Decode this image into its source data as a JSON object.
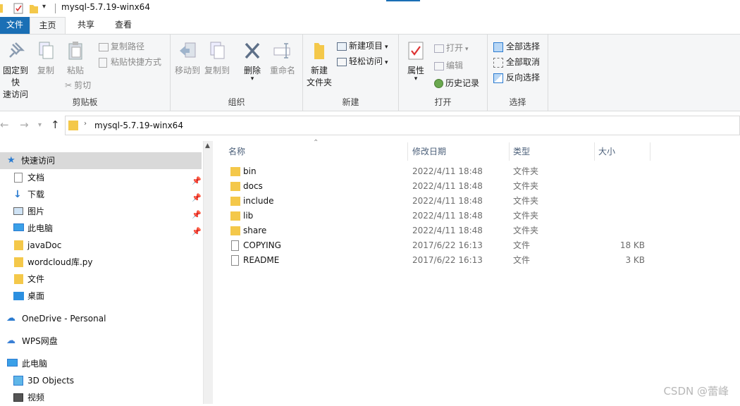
{
  "window": {
    "title": "mysql-5.7.19-winx64"
  },
  "tabs": [
    {
      "label": "文件"
    },
    {
      "label": "主页"
    },
    {
      "label": "共享"
    },
    {
      "label": "查看"
    }
  ],
  "ribbon": {
    "clipboard": {
      "label": "剪贴板",
      "pin_label": "固定到快速访问",
      "pin_line1": "固定到快",
      "pin_line2": "速访问",
      "copy": "复制",
      "paste": "粘贴",
      "copy_path": "复制路径",
      "paste_shortcut": "粘贴快捷方式",
      "cut": "剪切"
    },
    "organize": {
      "label": "组织",
      "move_to": "移动到",
      "copy_to": "复制到",
      "delete": "删除",
      "rename": "重命名"
    },
    "new": {
      "label": "新建",
      "new_folder_line1": "新建",
      "new_folder_line2": "文件夹",
      "new_item": "新建项目",
      "easy_access": "轻松访问"
    },
    "open": {
      "label": "打开",
      "properties": "属性",
      "open": "打开",
      "edit": "编辑",
      "history": "历史记录"
    },
    "select": {
      "label": "选择",
      "select_all": "全部选择",
      "select_none": "全部取消",
      "invert": "反向选择"
    }
  },
  "address": {
    "path": "mysql-5.7.19-winx64"
  },
  "nav": {
    "quick_access": "快速访问",
    "items": [
      {
        "label": "文档",
        "icon": "document-icon",
        "pinned": true
      },
      {
        "label": "下载",
        "icon": "download-icon",
        "pinned": true
      },
      {
        "label": "图片",
        "icon": "picture-icon",
        "pinned": true
      },
      {
        "label": "此电脑",
        "icon": "computer-icon",
        "pinned": true
      },
      {
        "label": "javaDoc",
        "icon": "folder-icon",
        "pinned": false
      },
      {
        "label": "wordcloud库.py",
        "icon": "folder-icon",
        "pinned": false
      },
      {
        "label": "文件",
        "icon": "folder-icon",
        "pinned": false
      },
      {
        "label": "桌面",
        "icon": "desktop-icon",
        "pinned": false
      }
    ],
    "onedrive": "OneDrive - Personal",
    "wps": "WPS网盘",
    "this_pc": "此电脑",
    "objects3d": "3D Objects",
    "videos": "视频"
  },
  "columns": {
    "name": "名称",
    "date": "修改日期",
    "type": "类型",
    "size": "大小"
  },
  "files": [
    {
      "name": "bin",
      "date": "2022/4/11 18:48",
      "type": "文件夹",
      "size": "",
      "kind": "folder"
    },
    {
      "name": "docs",
      "date": "2022/4/11 18:48",
      "type": "文件夹",
      "size": "",
      "kind": "folder"
    },
    {
      "name": "include",
      "date": "2022/4/11 18:48",
      "type": "文件夹",
      "size": "",
      "kind": "folder"
    },
    {
      "name": "lib",
      "date": "2022/4/11 18:48",
      "type": "文件夹",
      "size": "",
      "kind": "folder"
    },
    {
      "name": "share",
      "date": "2022/4/11 18:48",
      "type": "文件夹",
      "size": "",
      "kind": "folder"
    },
    {
      "name": "COPYING",
      "date": "2017/6/22 16:13",
      "type": "文件",
      "size": "18 KB",
      "kind": "file"
    },
    {
      "name": "README",
      "date": "2017/6/22 16:13",
      "type": "文件",
      "size": "3 KB",
      "kind": "file"
    }
  ],
  "watermark": "CSDN @蕾峰",
  "colors": {
    "accent": "#1a6fb5",
    "folder": "#f4c84a",
    "selected": "#d9d9d9"
  }
}
